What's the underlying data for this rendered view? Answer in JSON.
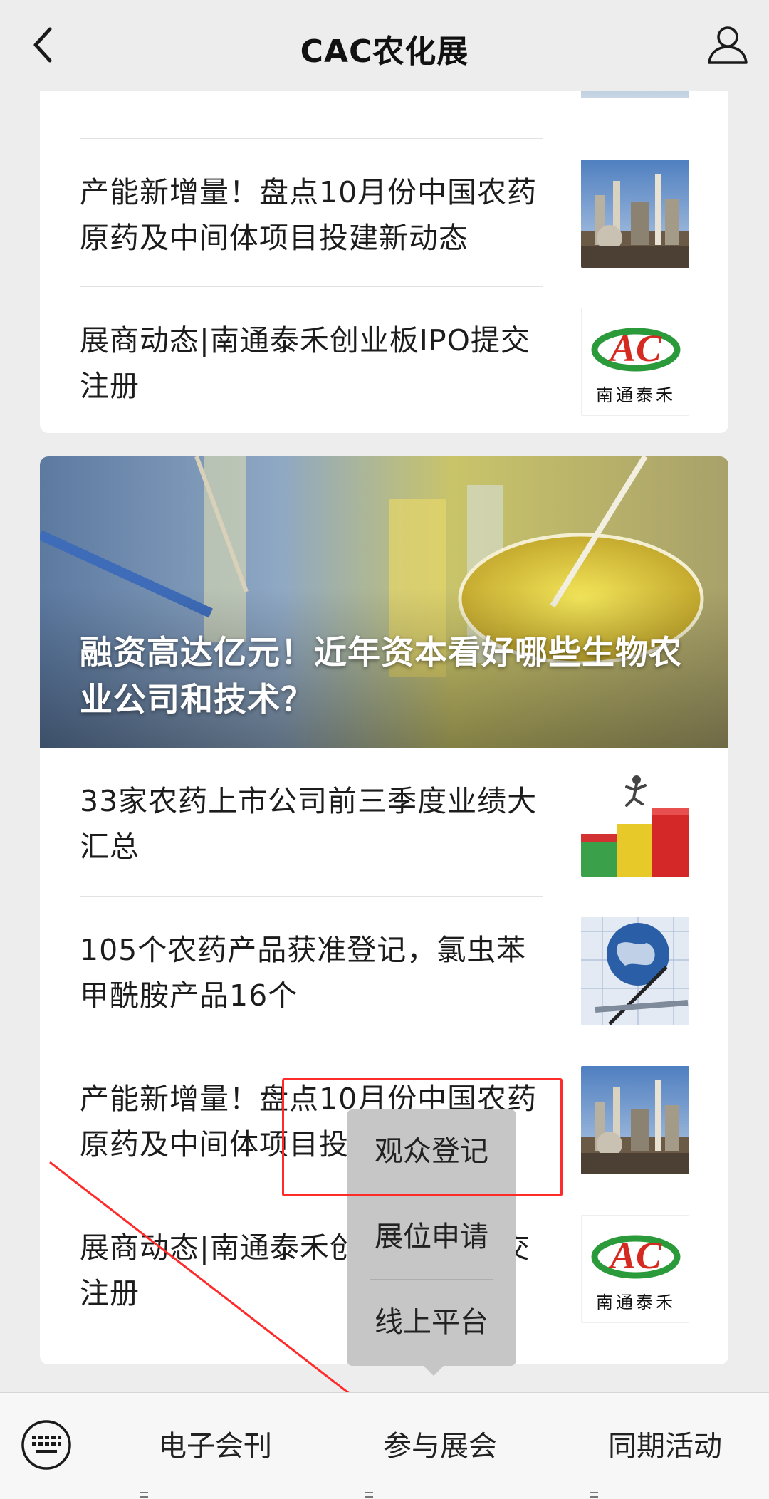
{
  "header": {
    "title": "CAC农化展"
  },
  "card1": {
    "items": [
      {
        "text": "产能新增量！盘点10月份中国农药原药及中间体项目投建新动态",
        "thumb": "refinery"
      },
      {
        "text": "展商动态|南通泰禾创业板IPO提交注册",
        "thumb": "logo"
      }
    ],
    "logo_text": "南通泰禾"
  },
  "card2": {
    "hero_title": "融资高达亿元！近年资本看好哪些生物农业公司和技术？",
    "items": [
      {
        "text": "33家农药上市公司前三季度业绩大汇总",
        "thumb": "chart"
      },
      {
        "text": "105个农药产品获准登记，氯虫苯甲酰胺产品16个",
        "thumb": "globe"
      },
      {
        "text": "产能新增量！盘点10月份中国农药原药及中间体项目投建新动态",
        "thumb": "refinery"
      },
      {
        "text": "展商动态|南通泰禾创业板IPO提交注册",
        "thumb": "logo"
      }
    ],
    "logo_text": "南通泰禾"
  },
  "popup": {
    "items": [
      "观众登记",
      "展位申请",
      "线上平台"
    ]
  },
  "bottom_menu": {
    "items": [
      "电子会刊",
      "参与展会",
      "同期活动"
    ]
  },
  "colors": {
    "annotation": "#ff2a2a",
    "popup_bg": "#c6c6c6",
    "page_bg": "#ededed"
  }
}
